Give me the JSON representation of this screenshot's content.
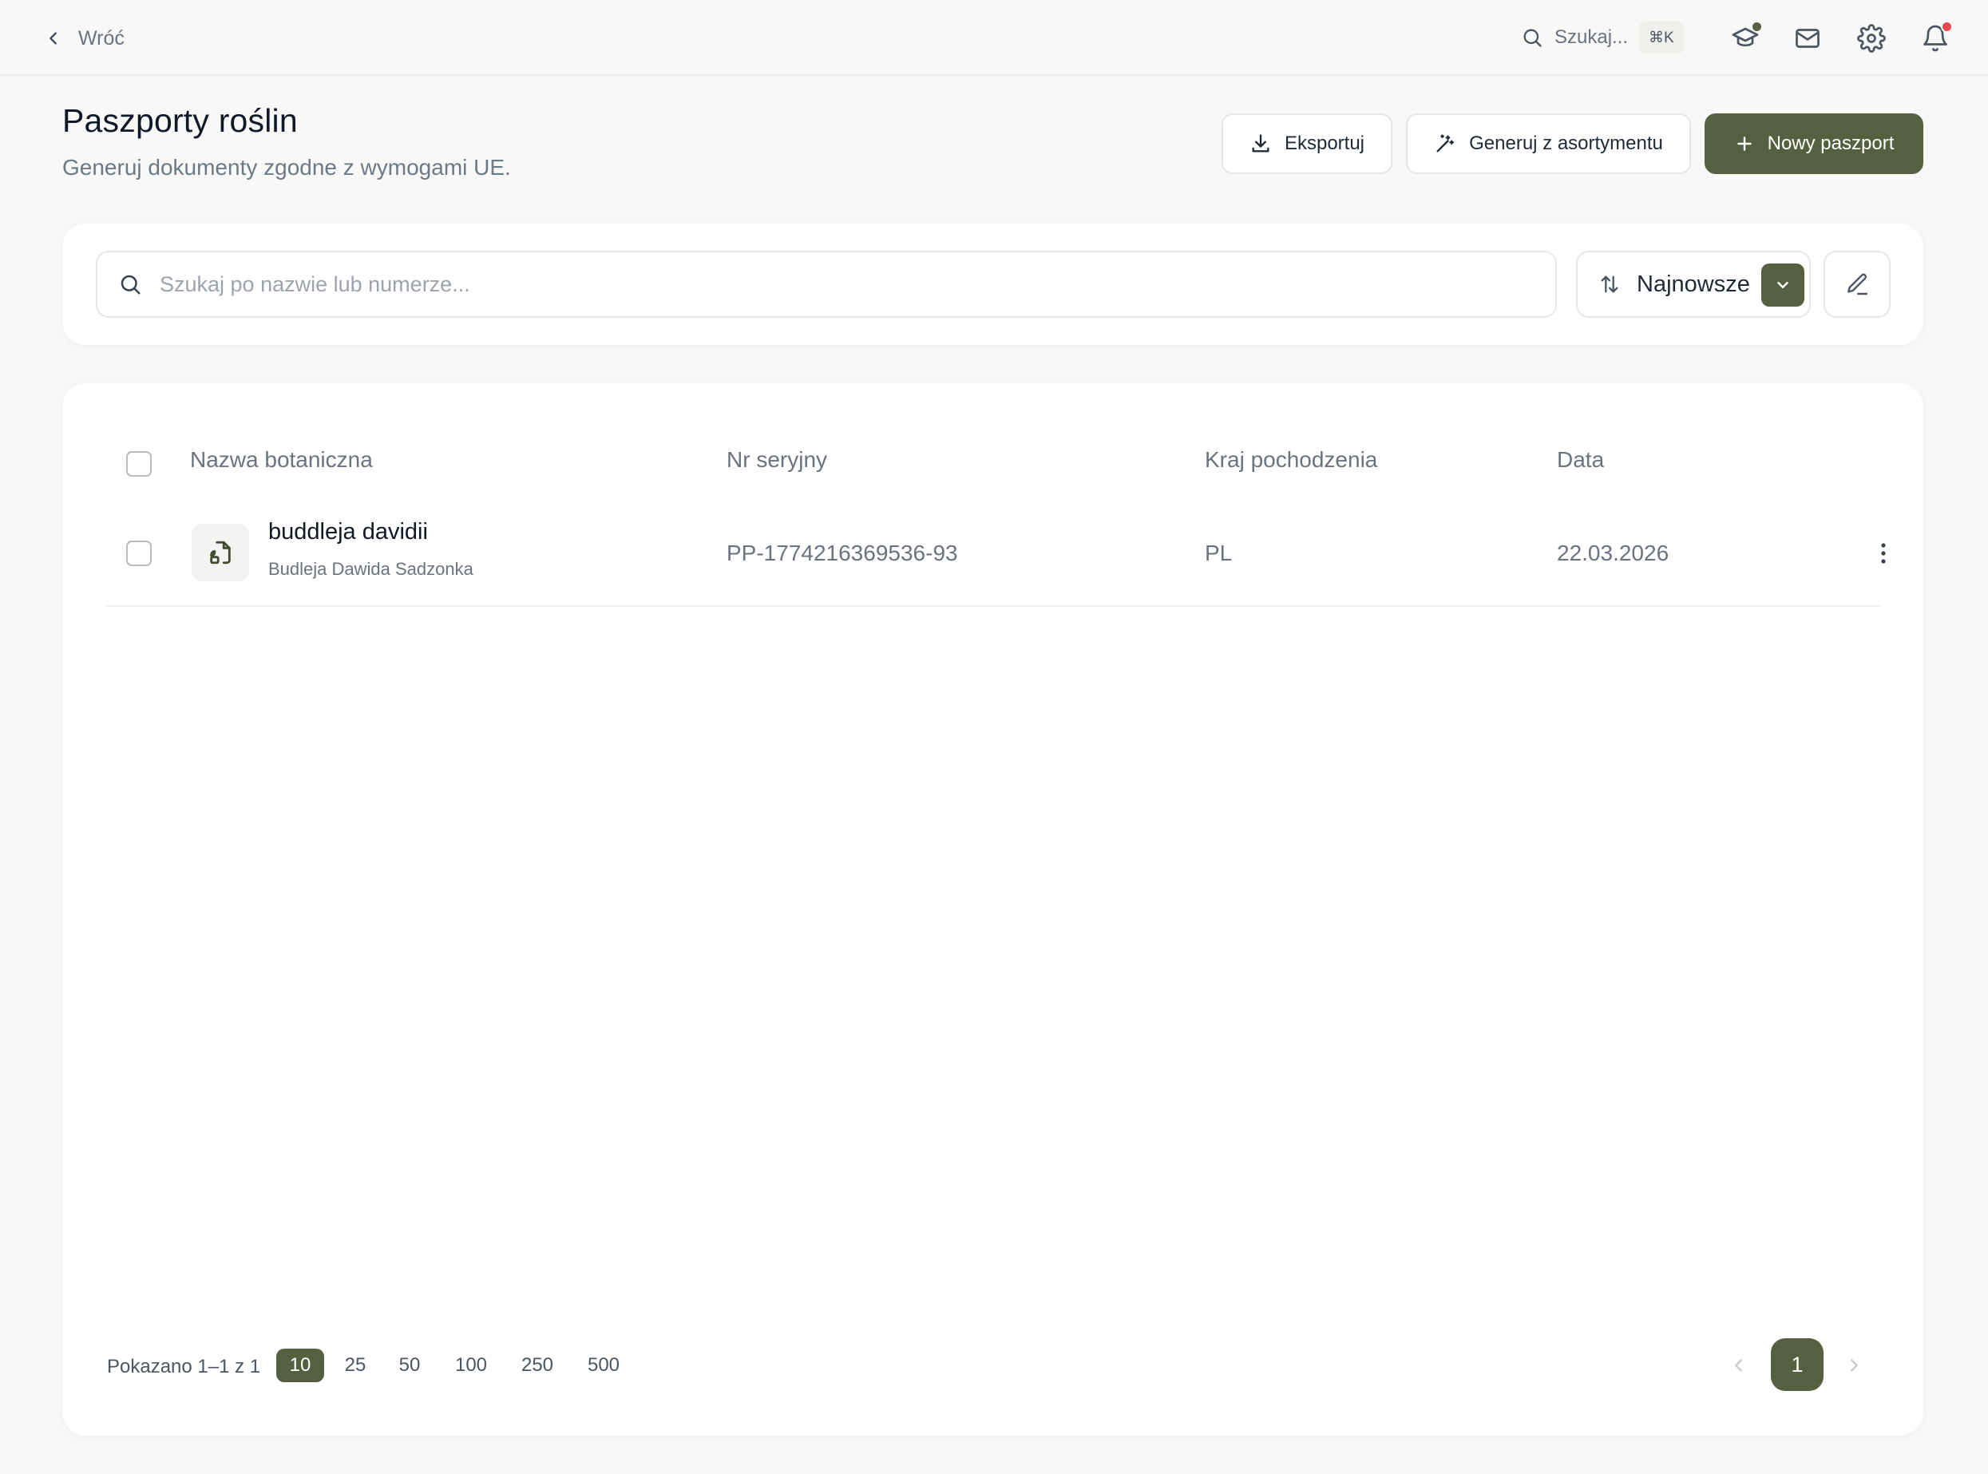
{
  "topbar": {
    "back_label": "Wróć",
    "search_label": "Szukaj...",
    "search_shortcut": "⌘K",
    "icons": [
      "graduation-cap-icon",
      "mail-icon",
      "gear-icon",
      "bell-icon"
    ],
    "status_colors": {
      "academy_dot": "#566040",
      "notification_dot": "#e5484d"
    }
  },
  "header": {
    "title": "Paszporty roślin",
    "subtitle": "Generuj dokumenty zgodne z wymogami UE.",
    "export_label": "Eksportuj",
    "generate_label": "Generuj z asortymentu",
    "new_label": "Nowy paszport"
  },
  "filters": {
    "search_placeholder": "Szukaj po nazwie lub numerze...",
    "sort_label": "Najnowsze"
  },
  "table": {
    "columns": [
      "Nazwa botaniczna",
      "Nr seryjny",
      "Kraj pochodzenia",
      "Data"
    ],
    "rows": [
      {
        "name": "buddleja davidii",
        "common_name": "Budleja Dawida Sadzonka",
        "serial": "PP-1774216369536-93",
        "country": "PL",
        "date": "22.03.2026"
      }
    ]
  },
  "pagination": {
    "showing": "Pokazano 1–1 z 1",
    "page_sizes": [
      "10",
      "25",
      "50",
      "100",
      "250",
      "500"
    ],
    "selected_page_size": "10",
    "current_page": "1"
  },
  "theme": {
    "accent": "#566040",
    "background": "#f8f8f6"
  }
}
